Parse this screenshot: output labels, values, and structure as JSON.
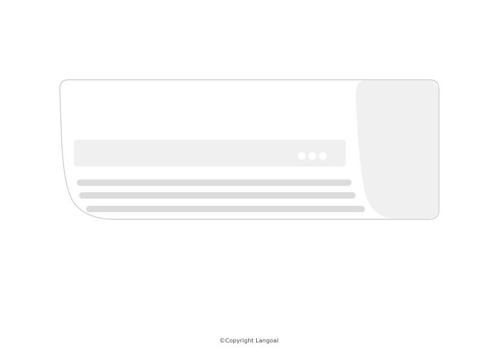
{
  "illustration": {
    "subject": "air-conditioner-indoor-unit-icon",
    "body_color": "#ffffff",
    "outline_color": "#c8c8c8",
    "side_panel_color": "#f0f0f0",
    "display_panel_color": "#f0f0f0",
    "indicator_light_color": "#ffffff",
    "indicator_light_count": 3,
    "louver_color": "#dcdcdc",
    "louver_count": 3
  },
  "footer": {
    "copyright": "©Copyright Langoal"
  }
}
